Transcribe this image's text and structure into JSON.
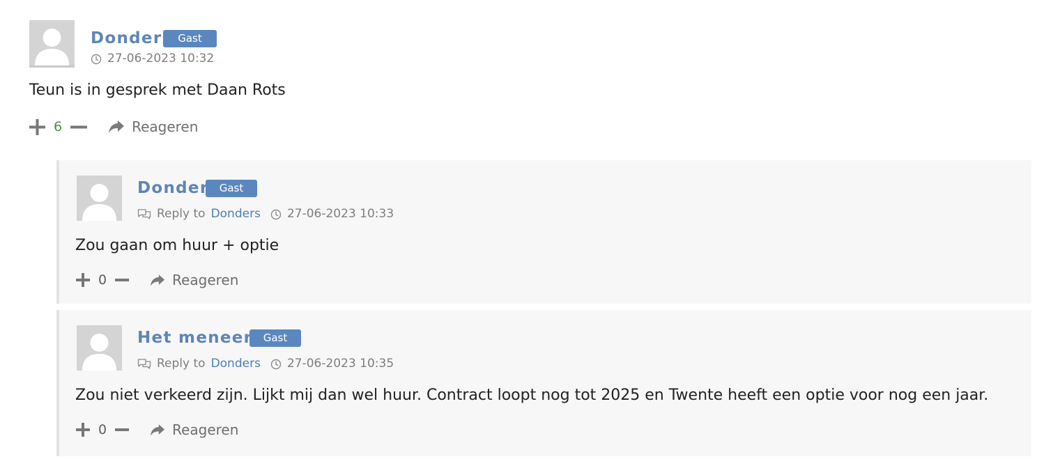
{
  "comments": [
    {
      "author": "Donders",
      "badge": "Gast",
      "timestamp": "27-06-2023 10:32",
      "text": "Teun is in gesprek met Daan Rots",
      "votes": "6",
      "reply_label": "Reageren"
    },
    {
      "author": "Donders",
      "badge": "Gast",
      "reply_prefix": "Reply to",
      "reply_target": "Donders",
      "timestamp": "27-06-2023 10:33",
      "text": "Zou gaan om huur + optie",
      "votes": "0",
      "reply_label": "Reageren"
    },
    {
      "author": "Het meneertje",
      "badge": "Gast",
      "reply_prefix": "Reply to",
      "reply_target": "Donders",
      "timestamp": "27-06-2023 10:35",
      "text": "Zou niet verkeerd zijn. Lijkt mij dan wel huur. Contract loopt nog tot 2025 en Twente heeft een optie voor nog een jaar.",
      "votes": "0",
      "reply_label": "Reageren"
    }
  ],
  "icons": {
    "avatar": "default-avatar-icon",
    "clock": "clock-icon",
    "reply_to": "chat-bubbles-icon",
    "vote_up": "plus-icon",
    "vote_down": "minus-icon",
    "reply": "share-arrow-icon"
  },
  "colors": {
    "author": "#5e86b4",
    "badge": "#5b87bf",
    "positive_votes": "#4a8f42",
    "child_background": "#f7f7f7"
  }
}
